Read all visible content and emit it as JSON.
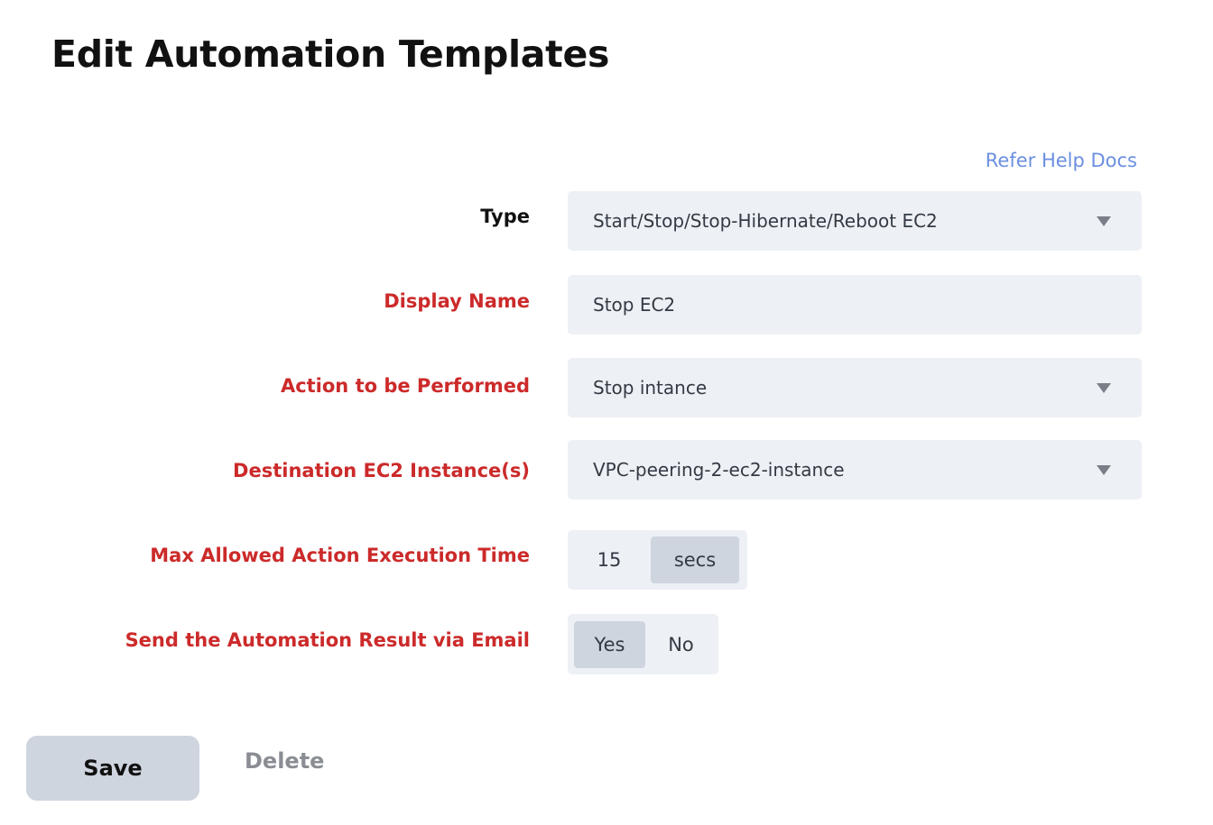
{
  "page": {
    "title": "Edit Automation Templates",
    "help_link": "Refer Help Docs"
  },
  "form": {
    "type": {
      "label": "Type",
      "value": "Start/Stop/Stop-Hibernate/Reboot EC2",
      "required": false
    },
    "display_name": {
      "label": "Display Name",
      "value": "Stop EC2",
      "required": true
    },
    "action": {
      "label": "Action to be Performed",
      "value": "Stop intance",
      "required": true
    },
    "destination": {
      "label": "Destination EC2 Instance(s)",
      "value": "VPC-peering-2-ec2-instance",
      "required": true
    },
    "max_time": {
      "label": "Max Allowed Action Execution Time",
      "value": "15",
      "unit": "secs",
      "required": true
    },
    "send_email": {
      "label": "Send the Automation Result via Email",
      "options": [
        "Yes",
        "No"
      ],
      "selected": "Yes",
      "required": true
    }
  },
  "actions": {
    "save_label": "Save",
    "delete_label": "Delete"
  },
  "colors": {
    "required_label": "#cc2a2a",
    "link": "#6b8fe0",
    "field_bg": "#edf0f5",
    "active_bg": "#cfd5df"
  },
  "icons": {
    "dropdown": "caret-down-icon"
  }
}
